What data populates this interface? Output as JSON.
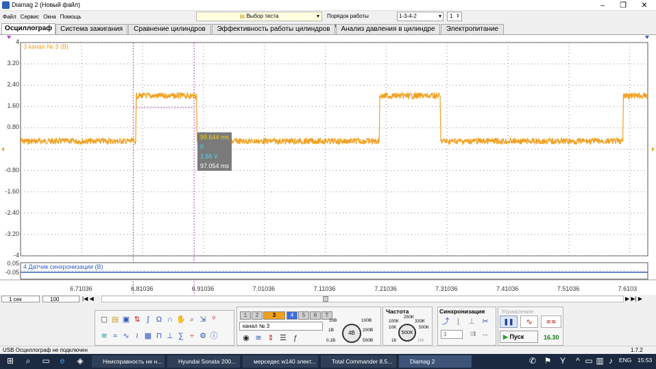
{
  "window": {
    "title": "Diamag 2 (Новый файл)"
  },
  "menu": [
    "Файл",
    "Сервис",
    "Окна",
    "Помощь"
  ],
  "toolbar": {
    "test_select": "Выбор теста",
    "order_label": "Порядок работы цилиндров",
    "order_value": "1-3-4-2",
    "cylinder_num": "1"
  },
  "tabs": [
    "Осциллограф",
    "Система зажигания",
    "Сравнение цилиндров",
    "Эффективность работы цилиндров",
    "Анализ давления в цилиндре",
    "Электропитание"
  ],
  "chart_data": [
    {
      "type": "line",
      "title": "3 канал № 3 (В)",
      "ylim": [
        -4,
        4
      ],
      "y_ticks": [
        "4",
        "3.20",
        "2.40",
        "1.60",
        "0.80",
        "",
        "-0.80",
        "-1.60",
        "-2.40",
        "-3.20",
        "-4"
      ],
      "x_ticks": [
        "6.71036",
        "6.81036",
        "6.91036",
        "7.01036",
        "7.11036",
        "7.21036",
        "7.31036",
        "7.41036",
        "7.51036",
        "7.6103"
      ],
      "series": [
        {
          "name": "канал № 3",
          "color": "#f0a020",
          "x": [
            6.61,
            6.799,
            6.8,
            6.899,
            6.9,
            7.199,
            7.2,
            7.299,
            7.3,
            7.599,
            7.6,
            7.64
          ],
          "y": [
            0.3,
            0.3,
            2.0,
            2.0,
            0.3,
            0.3,
            2.0,
            2.0,
            0.3,
            0.3,
            2.0,
            2.0
          ]
        }
      ]
    },
    {
      "type": "line",
      "title": "4 Датчик синхронизации (В)",
      "y_ticks": [
        "0.05",
        "-0.05"
      ],
      "series": [
        {
          "name": "Датчик синхронизации",
          "color": "#3060c0",
          "x": [
            6.61,
            7.64
          ],
          "y": [
            -0.03,
            -0.03
          ]
        }
      ]
    }
  ],
  "cursor": {
    "dt": "99.644 ms",
    "ch": "0",
    "v": "1.56 V",
    "t": "97.054 ms"
  },
  "timebase": {
    "value": "1 сек",
    "count": "100"
  },
  "channels": [
    "1",
    "2",
    "3",
    "4",
    "5",
    "6",
    "Т"
  ],
  "channel_name": "канал № 3",
  "amplitude": {
    "value": "4В",
    "marks": [
      "10В",
      "100В",
      "1В",
      "200В",
      "0,1В",
      "500В"
    ]
  },
  "frequency": {
    "title": "Частота",
    "value": "500К",
    "marks": [
      "250К",
      "100К",
      "333К",
      "10К",
      "500К",
      "1К",
      "1М"
    ]
  },
  "sync": {
    "title": "Синхронизация",
    "channel": "3"
  },
  "control": {
    "title": "Управление",
    "start": "Пуск",
    "version_num": "16.30"
  },
  "status": {
    "text": "USB Осциллограф не подключен",
    "version": "1.7.2"
  },
  "taskbar": {
    "items": [
      "Неисправность не н...",
      "Hyundai Sonata 200...",
      "мерседес w140 элект...",
      "Total Commander 8.5...",
      "Diamag 2"
    ],
    "lang": "ENG",
    "time": "15:53"
  },
  "colors": {
    "signal": "#f0a020",
    "sync": "#3060c0",
    "cursor": "#b040c0"
  }
}
